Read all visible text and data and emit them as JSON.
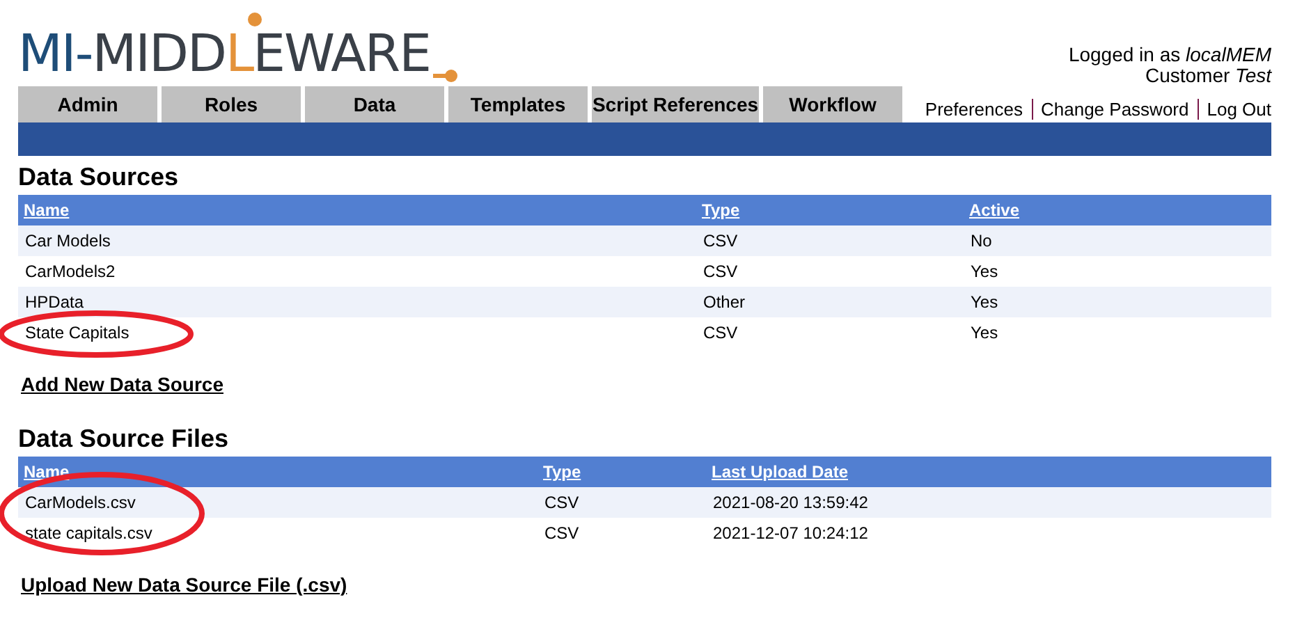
{
  "logo": {
    "prefix": "MI-",
    "main": "MIDD",
    "accent": "L",
    "rest": "EWARE"
  },
  "user": {
    "label": "Logged in as",
    "name": "localMEM",
    "customer_label": "Customer",
    "customer": "Test"
  },
  "tabs": [
    "Admin",
    "Roles",
    "Data",
    "Templates",
    "Script References",
    "Workflow"
  ],
  "user_links": [
    "Preferences",
    "Change Password",
    "Log Out"
  ],
  "sections": [
    {
      "title": "Data Sources",
      "columns": [
        "Name",
        "Type",
        "Active"
      ],
      "rows": [
        [
          "Car Models",
          "CSV",
          "No"
        ],
        [
          "CarModels2",
          "CSV",
          "Yes"
        ],
        [
          "HPData",
          "Other",
          "Yes"
        ],
        [
          "State Capitals",
          "CSV",
          "Yes"
        ]
      ],
      "action": "Add New Data Source"
    },
    {
      "title": "Data Source Files",
      "columns": [
        "Name",
        "Type",
        "Last Upload Date"
      ],
      "rows": [
        [
          "CarModels.csv",
          "CSV",
          "2021-08-20 13:59:42"
        ],
        [
          "state capitals.csv",
          "CSV",
          "2021-12-07 10:24:12"
        ]
      ],
      "action": "Upload New Data Source File (.csv)"
    }
  ]
}
